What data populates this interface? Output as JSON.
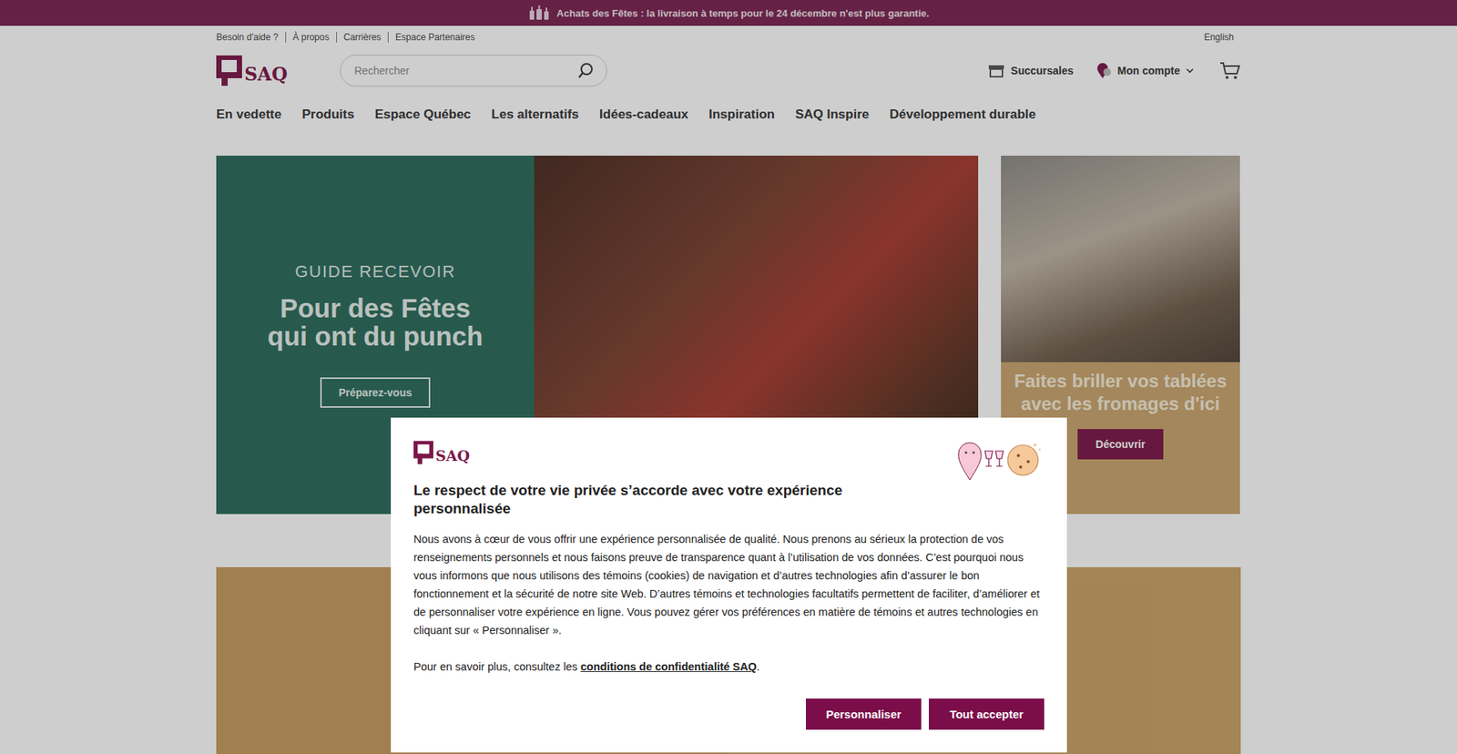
{
  "banner": {
    "text": "Achats des Fêtes : la livraison à temps pour le 24 décembre n'est plus garantie."
  },
  "utility_links": [
    "Besoin d'aide ?",
    "À propos",
    "Carrières",
    "Espace Partenaires"
  ],
  "language": "English",
  "logo": "SAQ",
  "search": {
    "placeholder": "Rechercher"
  },
  "header_actions": {
    "stores": "Succursales",
    "account": "Mon compte"
  },
  "nav": [
    "En vedette",
    "Produits",
    "Espace Québec",
    "Les alternatifs",
    "Idées-cadeaux",
    "Inspiration",
    "SAQ Inspire",
    "Développement durable"
  ],
  "hero": {
    "kicker": "GUIDE RECEVOIR",
    "title": [
      "Pour des Fêtes",
      "qui ont du punch"
    ],
    "button": "Préparez-vous"
  },
  "side_card": {
    "title": [
      "Faites briller vos tablées",
      "avec les fromages d'ici"
    ],
    "button": "Découvrir"
  },
  "cookie_dialog": {
    "logo": "SAQ",
    "title": "Le respect de votre vie privée s’accorde avec votre expérience personnalisée",
    "body": "Nous avons à cœur de vous offrir une expérience personnalisée de qualité. Nous prenons au sérieux la protection de vos renseignements personnels et nous faisons preuve de transparence quant à l’utilisation de vos données. C’est pourquoi nous vous informons que nous utilisons des témoins (cookies) de navigation et d’autres technologies afin d’assurer le bon fonctionnement et la sécurité de notre site Web. D’autres témoins et technologies facultatifs permettent de faciliter, d’améliorer et de personnaliser votre expérience en ligne. Vous pouvez gérer vos préférences en matière de témoins et autres technologies en cliquant sur « Personnaliser ».",
    "more_prefix": "Pour en savoir plus, consultez les ",
    "more_link": "conditions de confidentialité SAQ",
    "more_suffix": ".",
    "buttons": [
      "Personnaliser",
      "Tout accepter"
    ]
  }
}
